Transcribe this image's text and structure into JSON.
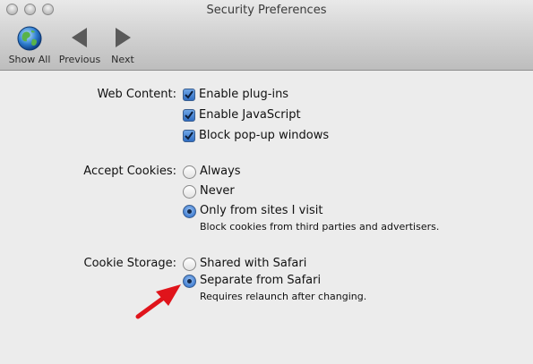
{
  "window": {
    "title": "Security Preferences"
  },
  "toolbar": {
    "show_all": "Show All",
    "previous": "Previous",
    "next": "Next"
  },
  "web_content": {
    "label": "Web Content:",
    "options": [
      {
        "label": "Enable plug-ins",
        "checked": true
      },
      {
        "label": "Enable JavaScript",
        "checked": true
      },
      {
        "label": "Block pop-up windows",
        "checked": true
      }
    ]
  },
  "accept_cookies": {
    "label": "Accept Cookies:",
    "options": [
      {
        "label": "Always",
        "selected": false
      },
      {
        "label": "Never",
        "selected": false
      },
      {
        "label": "Only from sites I visit",
        "selected": true
      }
    ],
    "hint": "Block cookies from third parties and advertisers."
  },
  "cookie_storage": {
    "label": "Cookie Storage:",
    "options": [
      {
        "label": "Shared with Safari",
        "selected": false
      },
      {
        "label": "Separate from Safari",
        "selected": true
      }
    ],
    "hint": "Requires relaunch after changing."
  },
  "colors": {
    "accent": "#3d7ad0",
    "annotation_arrow": "#e0141b"
  }
}
